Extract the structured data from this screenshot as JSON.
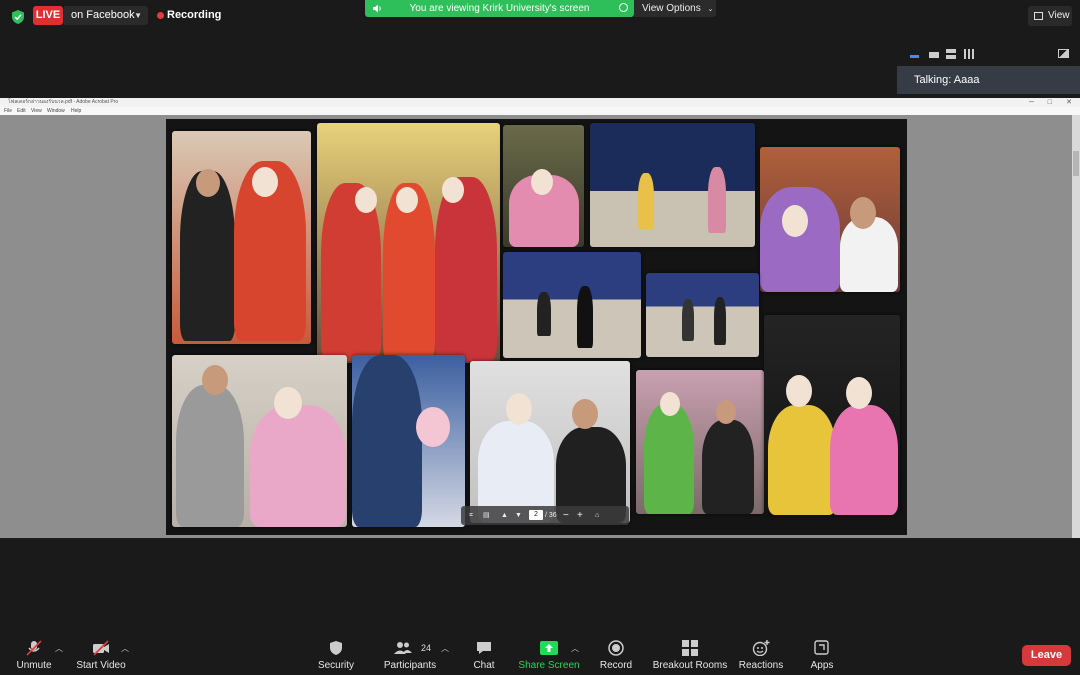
{
  "topbar": {
    "live_label": "LIVE",
    "platform_label": "on Facebook",
    "recording_label": "Recording",
    "viewing_banner": "You are viewing Krirk University's screen",
    "view_options_label": "View Options",
    "view_label": "View"
  },
  "talking_panel": {
    "text": "Talking: Aaaa"
  },
  "acrobat": {
    "title": "โฟลเดอร์กล่าวนองรับนวล.pdf - Adobe Acrobat Pro",
    "menu": [
      "File",
      "Edit",
      "View",
      "Window",
      "Help"
    ],
    "page_current": "2",
    "page_total": "/ 36"
  },
  "toolbar": {
    "unmute_label": "Unmute",
    "start_video_label": "Start Video",
    "security_label": "Security",
    "participants_label": "Participants",
    "participants_count": "24",
    "chat_label": "Chat",
    "share_screen_label": "Share Screen",
    "record_label": "Record",
    "breakout_label": "Breakout Rooms",
    "reactions_label": "Reactions",
    "apps_label": "Apps",
    "leave_label": "Leave"
  },
  "colors": {
    "live_red": "#e02f2f",
    "viewing_green": "#2fbf5a",
    "share_green": "#23d959",
    "leave_red": "#d7383b",
    "talking_bg": "#353c46"
  }
}
